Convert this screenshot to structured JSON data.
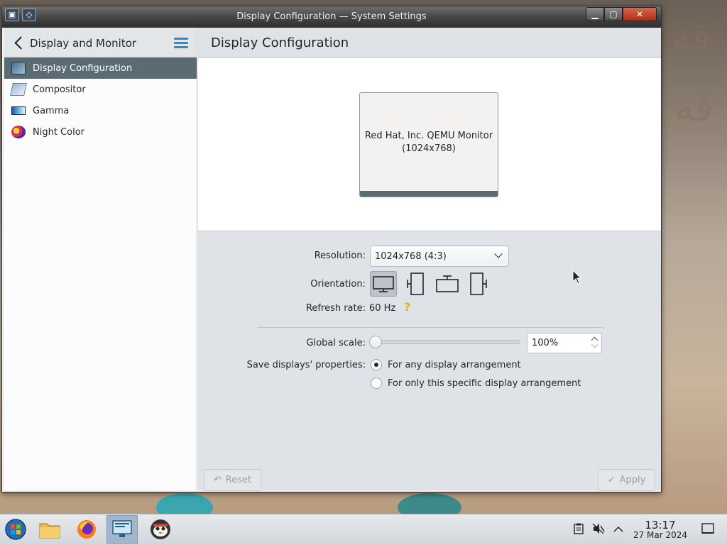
{
  "window": {
    "title": "Display Configuration — System Settings",
    "buttons": {
      "minimize": "▁",
      "maximize": "▢",
      "close": "✕"
    }
  },
  "sidebar": {
    "title": "Display and Monitor",
    "items": [
      {
        "label": "Display Configuration",
        "icon": "display-icon",
        "selected": true
      },
      {
        "label": "Compositor",
        "icon": "compositor-icon"
      },
      {
        "label": "Gamma",
        "icon": "gamma-icon"
      },
      {
        "label": "Night Color",
        "icon": "night-color-icon"
      }
    ]
  },
  "main": {
    "title": "Display Configuration",
    "monitor": {
      "name": "Red Hat, Inc. QEMU Monitor",
      "mode": "(1024x768)"
    },
    "resolution": {
      "label": "Resolution:",
      "value": "1024x768 (4:3)"
    },
    "orientation": {
      "label": "Orientation:",
      "options": [
        "normal",
        "rotate-left",
        "upside-down",
        "rotate-right"
      ],
      "selected": "normal"
    },
    "refresh": {
      "label": "Refresh rate:",
      "value": "60 Hz",
      "help": "?"
    },
    "scale": {
      "label": "Global scale:",
      "value": "100%",
      "slider_fraction": 0.0
    },
    "save": {
      "label": "Save displays' properties:",
      "options": [
        "For any display arrangement",
        "For only this specific display arrangement"
      ],
      "selected": 0
    },
    "buttons": {
      "reset": "Reset",
      "apply": "Apply"
    }
  },
  "taskbar": {
    "time": "13:17",
    "date": "27 Mar 2024"
  },
  "colors": {
    "accent": "#2d8ccc",
    "selection": "#5b6b73",
    "help": "#d4b81a"
  }
}
